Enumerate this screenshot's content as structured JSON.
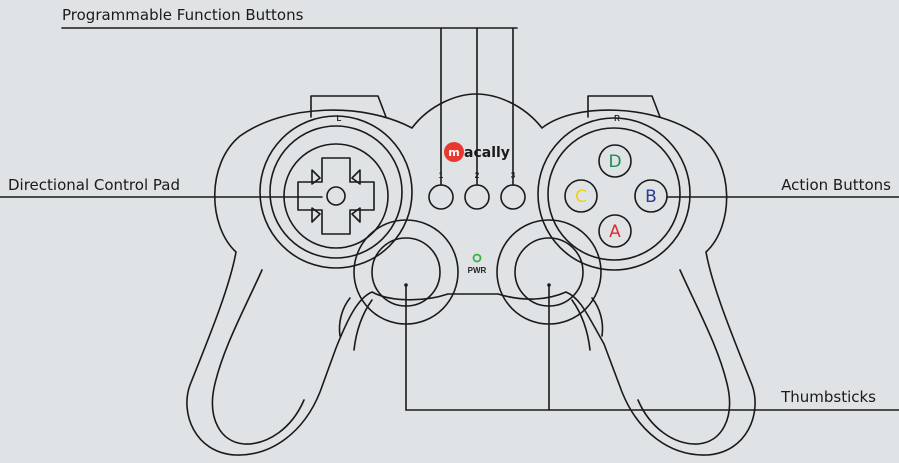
{
  "labels": {
    "programmable": "Programmable Function Buttons",
    "dpad": "Directional Control Pad",
    "action": "Action Buttons",
    "thumbsticks": "Thumbsticks"
  },
  "controller": {
    "brand": "acally",
    "brand_initial": "m",
    "shoulder_left": "L",
    "shoulder_right": "R",
    "function_buttons": [
      "1",
      "2",
      "3"
    ],
    "power": "PWR",
    "action_buttons": {
      "top": "D",
      "left": "C",
      "right": "B",
      "bottom": "A"
    }
  },
  "colors": {
    "background": "#dfe3e5",
    "outline": "#1a1a1a",
    "brand_red": "#e8392f",
    "button_a": "#e3282f",
    "button_b": "#2c3a92",
    "button_c": "#f2d11a",
    "button_d": "#1f8a52",
    "power_led": "#3cb043"
  }
}
